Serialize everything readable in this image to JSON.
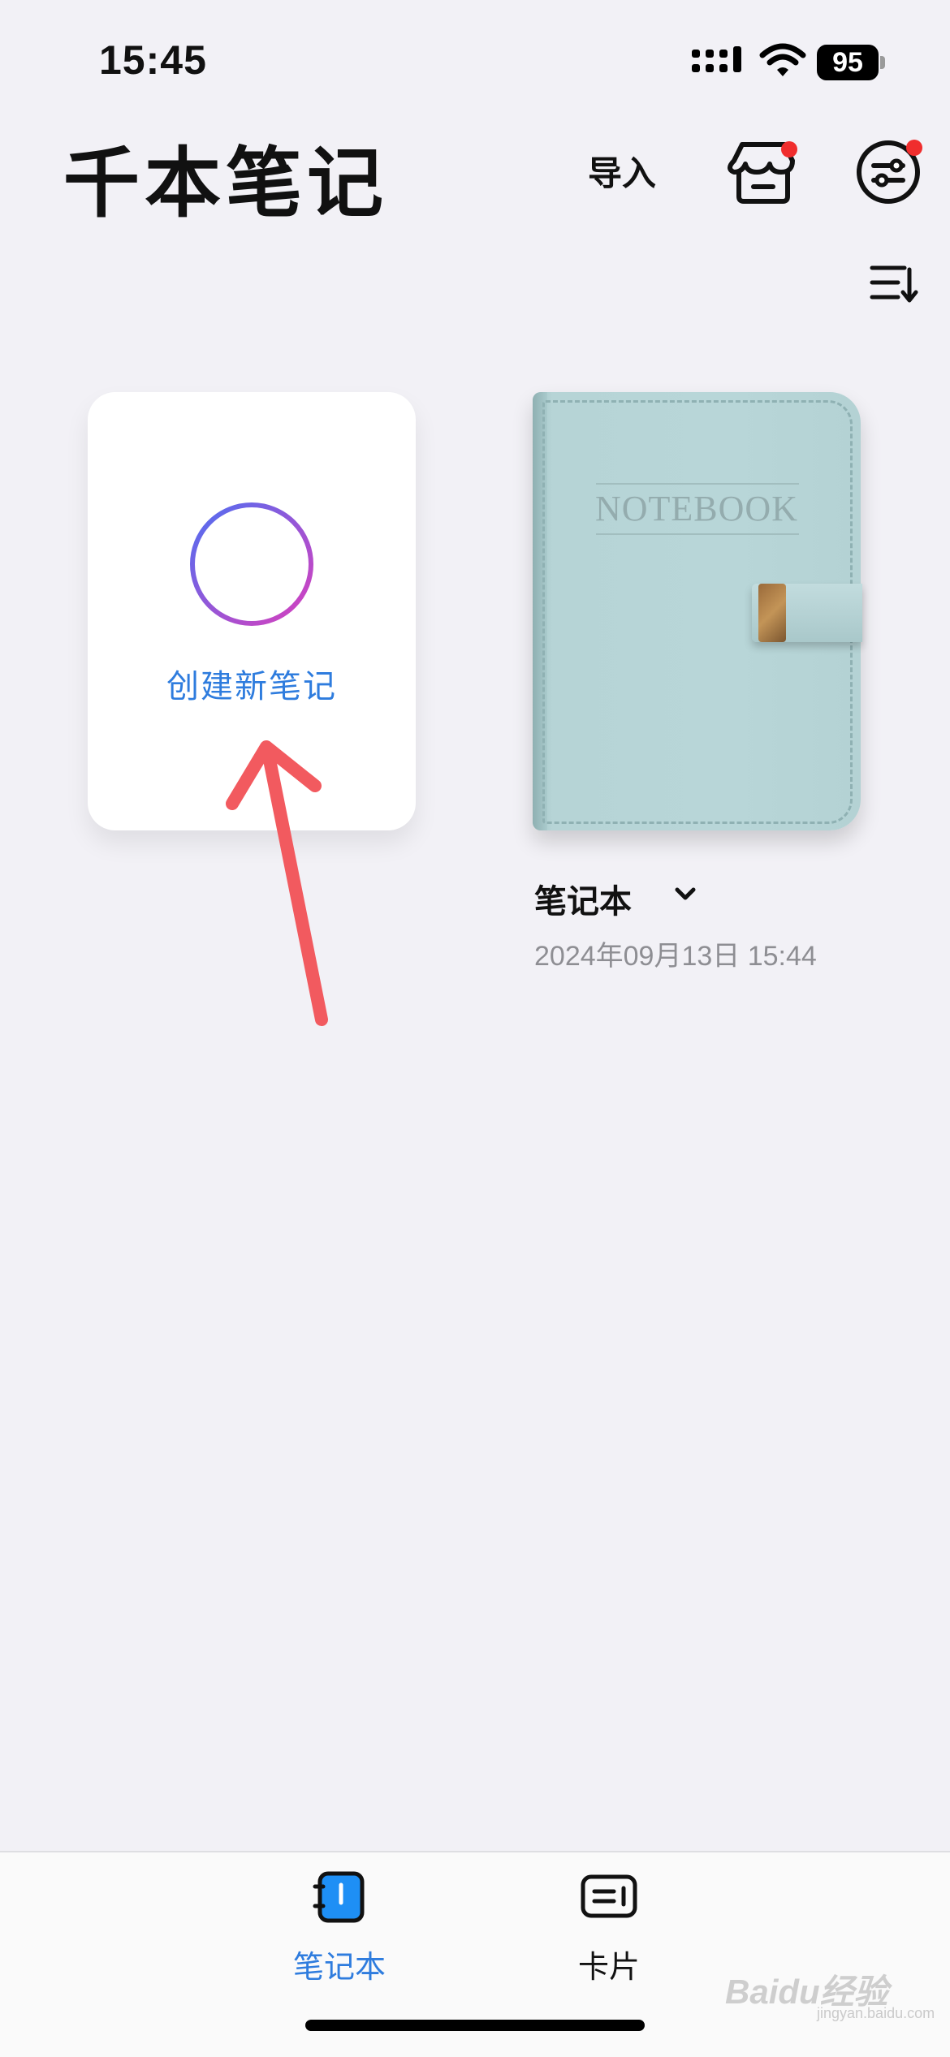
{
  "status_bar": {
    "time": "15:45",
    "battery": "95",
    "icons": [
      "cellular-signal-icon",
      "wifi-icon",
      "battery-icon"
    ]
  },
  "header": {
    "title": "千本笔记",
    "import_label": "导入",
    "icons": [
      "store-icon",
      "settings-sliders-icon",
      "sort-icon"
    ],
    "badge_color": "#f02d2d"
  },
  "create_card": {
    "label": "创建新笔记",
    "icon": "plus-circle-icon",
    "accent": "#2e7cde"
  },
  "notebooks": [
    {
      "cover_title": "NOTEBOOK",
      "name": "笔记本",
      "date": "2024年09月13日 15:44",
      "cover_color": "#b8d6d8"
    }
  ],
  "tabbar": {
    "tabs": [
      {
        "label": "笔记本",
        "icon": "notebook-icon",
        "active": true
      },
      {
        "label": "卡片",
        "icon": "card-icon",
        "active": false
      }
    ],
    "active_color": "#2e7cde"
  },
  "watermark": {
    "brand": "Baidu经验",
    "url": "jingyan.baidu.com"
  }
}
